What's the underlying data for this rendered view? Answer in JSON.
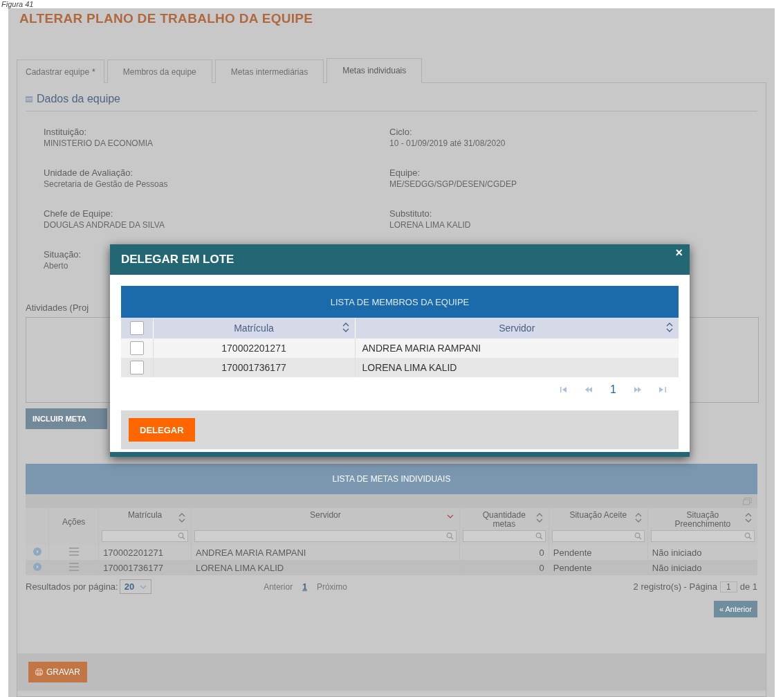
{
  "figure_caption": "Figura 41",
  "page_title": "ALTERAR PLANO DE TRABALHO DA EQUIPE",
  "tabs": [
    {
      "label": "Cadastrar equipe",
      "required_mark": "*",
      "selected": false
    },
    {
      "label": "Membros da equipe",
      "selected": false
    },
    {
      "label": "Metas intermediárias",
      "selected": false
    },
    {
      "label": "Metas individuais",
      "selected": true
    }
  ],
  "section": {
    "title": "Dados da equipe",
    "fields": [
      {
        "label": "Instituição:",
        "value": "MINISTERIO DA ECONOMIA"
      },
      {
        "label": "Ciclo:",
        "value": "10 - 01/09/2019 até 31/08/2020"
      },
      {
        "label": "Unidade de Avaliação:",
        "value": "Secretaria de Gestão de Pessoas"
      },
      {
        "label": "Equipe:",
        "value": "ME/SEDGG/SGP/DESEN/CGDEP"
      },
      {
        "label": "Chefe de Equipe:",
        "value": "DOUGLAS ANDRADE DA SILVA"
      },
      {
        "label": "Substituto:",
        "value": "LORENA LIMA KALID"
      },
      {
        "label": "Situação:",
        "value": "Aberto"
      }
    ]
  },
  "activities_label": "Atividades (Proj",
  "add_goal_button": "INCLUIR META",
  "modal": {
    "title": "DELEGAR EM LOTE",
    "close": "×",
    "table_title": "LISTA DE MEMBROS DA EQUIPE",
    "select_all_checked": false,
    "columns": [
      "Matrícula",
      "Servidor"
    ],
    "rows": [
      {
        "checked": false,
        "matricula": "170002201271",
        "servidor": "ANDREA MARIA RAMPANI"
      },
      {
        "checked": false,
        "matricula": "170001736177",
        "servidor": "LORENA LIMA KALID"
      }
    ],
    "page": "1",
    "button": "DELEGAR"
  },
  "goals_table": {
    "title": "LISTA DE METAS INDIVIDUAIS",
    "columns": [
      {
        "label": "Ações",
        "sortable": false,
        "filter": false
      },
      {
        "label": "Matrícula",
        "sortable": true,
        "sorted_descending": false,
        "filter": true
      },
      {
        "label": "Servidor",
        "sortable": true,
        "sorted_descending": true,
        "filter": true
      },
      {
        "label": "Quantidade metas",
        "sortable": true,
        "sorted_descending": false,
        "filter": true
      },
      {
        "label": "Situação Aceite",
        "sortable": true,
        "sorted_descending": false,
        "filter": true
      },
      {
        "label": "Situação Preenchimento",
        "sortable": true,
        "sorted_descending": false,
        "filter": true
      }
    ],
    "rows": [
      {
        "matricula": "170002201271",
        "servidor": "ANDREA MARIA RAMPANI",
        "quantidade": "0",
        "aceite": "Pendente",
        "preenchimento": "Não iniciado"
      },
      {
        "matricula": "170001736177",
        "servidor": "LORENA LIMA KALID",
        "quantidade": "0",
        "aceite": "Pendente",
        "preenchimento": "Não iniciado"
      }
    ],
    "per_page_label": "Resultados por página:",
    "per_page": "20",
    "pager_prev": "Anterior",
    "pager_page": "1",
    "pager_next": "Próximo",
    "summary_prefix": "2 registro(s) - Página",
    "page_input": "1",
    "summary_suffix": "de 1",
    "back_button": "« Anterior"
  },
  "save_button": "GRAVAR"
}
